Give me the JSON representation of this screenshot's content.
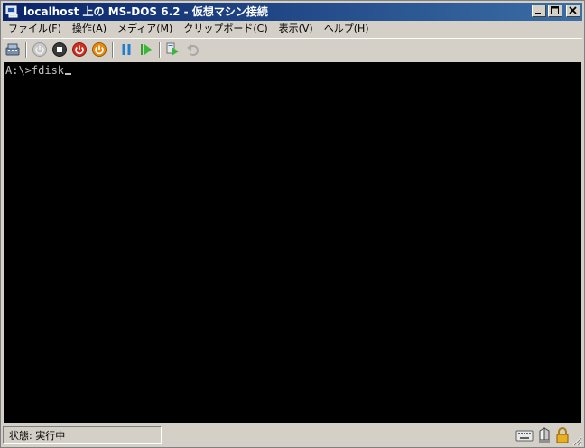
{
  "window": {
    "title": "localhost 上の MS-DOS 6.2 - 仮想マシン接続"
  },
  "menu": {
    "items": [
      {
        "label": "ファイル(F)"
      },
      {
        "label": "操作(A)"
      },
      {
        "label": "メディア(M)"
      },
      {
        "label": "クリップボード(C)"
      },
      {
        "label": "表示(V)"
      },
      {
        "label": "ヘルプ(H)"
      }
    ]
  },
  "toolbar": {
    "icons": [
      "ctrl-alt-del-icon",
      "start-icon",
      "turn-off-icon",
      "shut-down-icon",
      "save-icon",
      "pause-icon",
      "resume-icon",
      "snapshot-icon",
      "revert-icon"
    ]
  },
  "console": {
    "prompt": "A:\\>",
    "command": "fdisk"
  },
  "status": {
    "text": "状態: 実行中"
  },
  "colors": {
    "titlebar_start": "#0a246a",
    "titlebar_end": "#3a6ea5",
    "console_bg": "#000000",
    "console_fg": "#c0c0c0"
  }
}
